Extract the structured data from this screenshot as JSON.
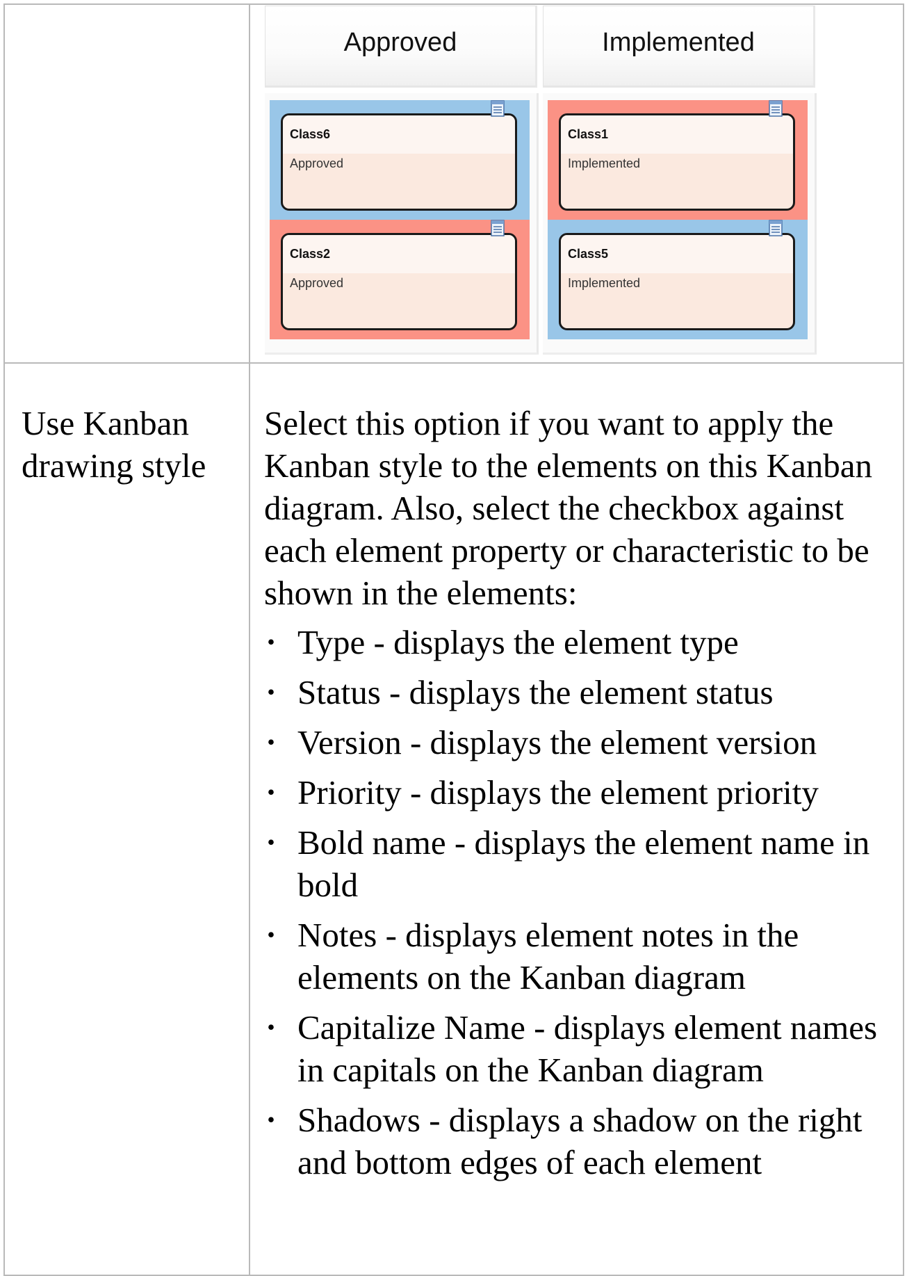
{
  "kanban": {
    "lanes": [
      {
        "header": "Approved",
        "cards": [
          {
            "name": "Class6",
            "status": "Approved",
            "tile_color": "#99c6e8"
          },
          {
            "name": "Class2",
            "status": "Approved",
            "tile_color": "#fb9285"
          }
        ]
      },
      {
        "header": "Implemented",
        "cards": [
          {
            "name": "Class1",
            "status": "Implemented",
            "tile_color": "#fb9285"
          },
          {
            "name": "Class5",
            "status": "Implemented",
            "tile_color": "#99c6e8"
          }
        ]
      }
    ],
    "icon": "note-icon"
  },
  "option": {
    "term": "Use Kanban drawing style",
    "intro": "Select this option if you want to apply the Kanban style to the elements on this Kanban diagram. Also, select the checkbox against each element property or characteristic to be shown in the elements:",
    "bullet_glyph": "•",
    "bullets": [
      "Type - displays the element type",
      "Status - displays the element status",
      "Version - displays the element version",
      "Priority - displays the element priority",
      "Bold name - displays the element name in bold",
      "Notes - displays element notes in the elements on the Kanban diagram",
      "Capitalize Name - displays element names in capitals on the Kanban diagram",
      "Shadows - displays a shadow on the right and bottom edges of each element"
    ]
  }
}
